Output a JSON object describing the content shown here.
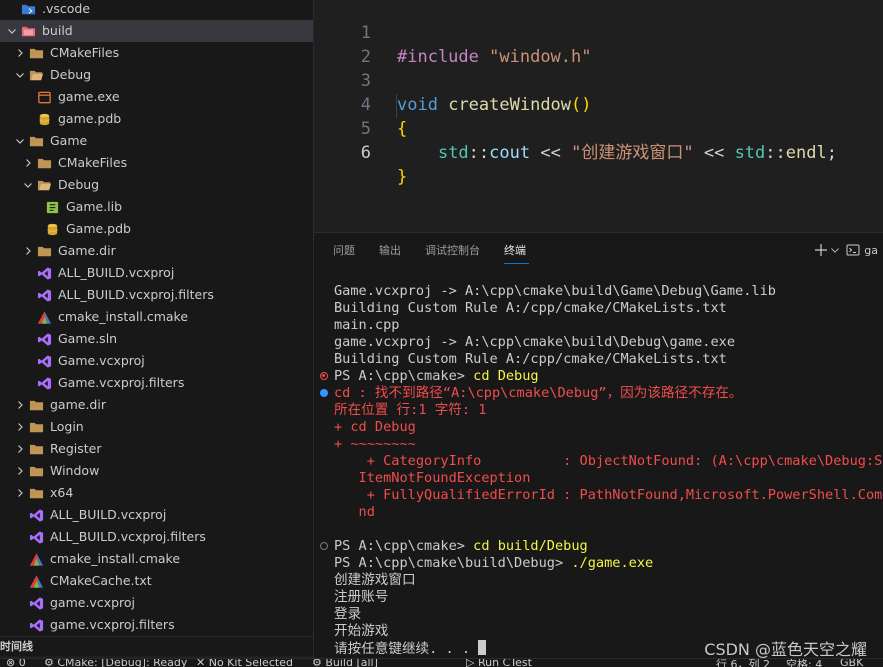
{
  "explorer": {
    "items": [
      {
        "label": ".vscode",
        "kind": "folder-vscode",
        "chevron": "none",
        "level": 0
      },
      {
        "label": "build",
        "kind": "folder-build",
        "chevron": "open",
        "level": 0,
        "selected": true
      },
      {
        "label": "CMakeFiles",
        "kind": "folder",
        "chevron": "closed",
        "level": 1
      },
      {
        "label": "Debug",
        "kind": "folder-open",
        "chevron": "open",
        "level": 1
      },
      {
        "label": "game.exe",
        "kind": "exe",
        "chevron": "none",
        "level": 2
      },
      {
        "label": "game.pdb",
        "kind": "db",
        "chevron": "none",
        "level": 2
      },
      {
        "label": "Game",
        "kind": "folder",
        "chevron": "open",
        "level": 1
      },
      {
        "label": "CMakeFiles",
        "kind": "folder",
        "chevron": "closed",
        "level": 2
      },
      {
        "label": "Debug",
        "kind": "folder-open",
        "chevron": "open",
        "level": 2
      },
      {
        "label": "Game.lib",
        "kind": "lib",
        "chevron": "none",
        "level": 3
      },
      {
        "label": "Game.pdb",
        "kind": "db",
        "chevron": "none",
        "level": 3
      },
      {
        "label": "Game.dir",
        "kind": "folder",
        "chevron": "closed",
        "level": 2
      },
      {
        "label": "ALL_BUILD.vcxproj",
        "kind": "vs",
        "chevron": "none",
        "level": 2
      },
      {
        "label": "ALL_BUILD.vcxproj.filters",
        "kind": "vs",
        "chevron": "none",
        "level": 2
      },
      {
        "label": "cmake_install.cmake",
        "kind": "cmake",
        "chevron": "none",
        "level": 2
      },
      {
        "label": "Game.sln",
        "kind": "vs",
        "chevron": "none",
        "level": 2
      },
      {
        "label": "Game.vcxproj",
        "kind": "vs",
        "chevron": "none",
        "level": 2
      },
      {
        "label": "Game.vcxproj.filters",
        "kind": "vs",
        "chevron": "none",
        "level": 2
      },
      {
        "label": "game.dir",
        "kind": "folder",
        "chevron": "closed",
        "level": 1
      },
      {
        "label": "Login",
        "kind": "folder",
        "chevron": "closed",
        "level": 1
      },
      {
        "label": "Register",
        "kind": "folder",
        "chevron": "closed",
        "level": 1
      },
      {
        "label": "Window",
        "kind": "folder",
        "chevron": "closed",
        "level": 1
      },
      {
        "label": "x64",
        "kind": "folder",
        "chevron": "closed",
        "level": 1
      },
      {
        "label": "ALL_BUILD.vcxproj",
        "kind": "vs",
        "chevron": "none",
        "level": 1
      },
      {
        "label": "ALL_BUILD.vcxproj.filters",
        "kind": "vs",
        "chevron": "none",
        "level": 1
      },
      {
        "label": "cmake_install.cmake",
        "kind": "cmake",
        "chevron": "none",
        "level": 1
      },
      {
        "label": "CMakeCache.txt",
        "kind": "cmake",
        "chevron": "none",
        "level": 1
      },
      {
        "label": "game.vcxproj",
        "kind": "vs",
        "chevron": "none",
        "level": 1
      },
      {
        "label": "game.vcxproj.filters",
        "kind": "vs",
        "chevron": "none",
        "level": 1
      }
    ],
    "timeline_label": "时间线"
  },
  "editor": {
    "lines": [
      {
        "num": "1",
        "text": "#include \"window.h\""
      },
      {
        "num": "2",
        "text": ""
      },
      {
        "num": "3",
        "text": "void createWindow()"
      },
      {
        "num": "4",
        "text": "{"
      },
      {
        "num": "5",
        "text": "    std::cout << \"创建游戏窗口\" << std::endl;"
      },
      {
        "num": "6",
        "text": "}"
      }
    ],
    "active_line": "6"
  },
  "panel": {
    "tabs": [
      {
        "label": "问题",
        "active": false
      },
      {
        "label": "输出",
        "active": false
      },
      {
        "label": "调试控制台",
        "active": false
      },
      {
        "label": "终端",
        "active": true
      }
    ],
    "new_terminal_icon": "plus-icon",
    "terminal_name": "ga"
  },
  "terminal": {
    "lines": [
      {
        "text": "Game.vcxproj -> A:\\cpp\\cmake\\build\\Game\\Debug\\Game.lib",
        "style": "normal"
      },
      {
        "text": "Building Custom Rule A:/cpp/cmake/CMakeLists.txt",
        "style": "normal"
      },
      {
        "text": "main.cpp",
        "style": "normal"
      },
      {
        "text": "game.vcxproj -> A:\\cpp\\cmake\\build\\Debug\\game.exe",
        "style": "normal"
      },
      {
        "text": "Building Custom Rule A:/cpp/cmake/CMakeLists.txt",
        "style": "normal"
      },
      {
        "prompt": "PS A:\\cpp\\cmake> ",
        "command": "cd Debug",
        "style": "prompt",
        "deco": "fail"
      },
      {
        "text": "cd : 找不到路径“A:\\cpp\\cmake\\Debug”，因为该路径不存在。",
        "style": "err",
        "deco": "dot"
      },
      {
        "text": "所在位置 行:1 字符: 1",
        "style": "err"
      },
      {
        "text": "+ cd Debug",
        "style": "err"
      },
      {
        "text": "+ ~~~~~~~~",
        "style": "err"
      },
      {
        "text": "    + CategoryInfo          : ObjectNotFound: (A:\\cpp\\cmake\\Debug:Str",
        "style": "err"
      },
      {
        "text": "   ItemNotFoundException",
        "style": "err"
      },
      {
        "text": "    + FullyQualifiedErrorId : PathNotFound,Microsoft.PowerShell.Comma",
        "style": "err"
      },
      {
        "text": "   nd",
        "style": "err"
      },
      {
        "text": "",
        "style": "normal"
      },
      {
        "prompt": "PS A:\\cpp\\cmake> ",
        "command": "cd build/Debug",
        "style": "prompt",
        "deco": "ok"
      },
      {
        "prompt": "PS A:\\cpp\\cmake\\build\\Debug> ",
        "command": "./game.exe",
        "style": "prompt"
      },
      {
        "text": "创建游戏窗口",
        "style": "normal"
      },
      {
        "text": "注册账号",
        "style": "normal"
      },
      {
        "text": "登录",
        "style": "normal"
      },
      {
        "text": "开始游戏",
        "style": "normal"
      },
      {
        "text": "请按任意键继续. . . ",
        "style": "cursor"
      }
    ]
  },
  "watermark": "CSDN @蓝色天空之耀",
  "statusbar": {
    "items": [
      "⊗ 0",
      "⚙ CMake: [Debug]: Ready",
      "✕ No Kit Selected",
      "⚙ Build  [all]",
      "▷ Run CTest",
      "行 6，列 2",
      "空格: 4",
      "GBK"
    ]
  },
  "colors": {
    "accent": "#0078d4",
    "error": "#f14c4c",
    "command": "#f5f543",
    "selection": "#37373d"
  }
}
